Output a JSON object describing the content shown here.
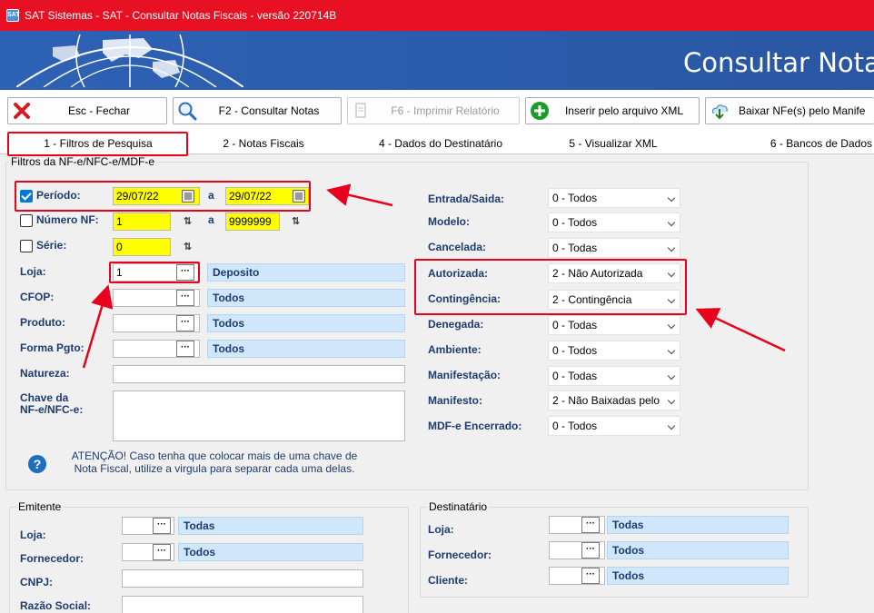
{
  "window": {
    "title": "SAT Sistemas - SAT - Consultar Notas Fiscais - versão 220714B",
    "icon_text": "SAT"
  },
  "banner": {
    "title": "Consultar Notas"
  },
  "toolbar": {
    "close_label": "Esc - Fechar",
    "consult_label": "F2 - Consultar Notas",
    "print_label": "F6 - Imprimir Relatório",
    "insert_xml_label": "Inserir pelo arquivo XML",
    "download_label": "Baixar NFe(s) pelo Manife"
  },
  "tabs": [
    {
      "label": "1 - Filtros de Pesquisa"
    },
    {
      "label": "2 - Notas Fiscais"
    },
    {
      "label": "4 - Dados do Destinatário"
    },
    {
      "label": "5 - Visualizar XML"
    },
    {
      "label": "6 - Bancos de Dados"
    }
  ],
  "filters": {
    "group_title": "Filtros da NF-e/NFC-e/MDF-e",
    "periodo": {
      "label": "Período:",
      "checked": true,
      "from": "29/07/22",
      "to": "29/07/22"
    },
    "numero": {
      "label": "Número NF:",
      "checked": false,
      "from": "1",
      "to": "9999999"
    },
    "serie": {
      "label": "Série:",
      "checked": false,
      "value": "0"
    },
    "range_sep": "a",
    "loja": {
      "label": "Loja:",
      "value": "1",
      "desc": "Deposito"
    },
    "cfop": {
      "label": "CFOP:",
      "value": "",
      "desc": "Todos"
    },
    "produto": {
      "label": "Produto:",
      "value": "",
      "desc": "Todos"
    },
    "forma_pgto": {
      "label": "Forma Pgto:",
      "value": "",
      "desc": "Todos"
    },
    "natureza": {
      "label": "Natureza:",
      "value": ""
    },
    "chave": {
      "label_line1": "Chave da",
      "label_line2": "NF-e/NFC-e:",
      "value": ""
    },
    "ellipsis": "···",
    "note_line1": "ATENÇÃO! Caso tenha que colocar mais de uma chave de",
    "note_line2": "Nota Fiscal, utilize a virgula para separar cada uma delas.",
    "note_icon": "?"
  },
  "right_filters": [
    {
      "label": "Entrada/Saida:",
      "value": "0 - Todos"
    },
    {
      "label": "Modelo:",
      "value": "0 - Todos"
    },
    {
      "label": "Cancelada:",
      "value": "0 - Todas"
    },
    {
      "label": "Autorizada:",
      "value": "2 - Não Autorizada"
    },
    {
      "label": "Contingência:",
      "value": "2 - Contingência"
    },
    {
      "label": "Denegada:",
      "value": "0 - Todas"
    },
    {
      "label": "Ambiente:",
      "value": "0 - Todos"
    },
    {
      "label": "Manifestação:",
      "value": "0 - Todas"
    },
    {
      "label": "Manifesto:",
      "value": "2 - Não Baixadas pelo"
    },
    {
      "label": "MDF-e Encerrado:",
      "value": "0 - Todos"
    }
  ],
  "emitente": {
    "group_title": "Emitente",
    "loja": {
      "label": "Loja:",
      "desc": "Todas"
    },
    "fornecedor": {
      "label": "Fornecedor:",
      "desc": "Todos"
    },
    "cnpj": {
      "label": "CNPJ:"
    },
    "razao": {
      "label": "Razão Social:"
    }
  },
  "destinatario": {
    "group_title": "Destinatário",
    "loja": {
      "label": "Loja:",
      "desc": "Todas"
    },
    "fornecedor": {
      "label": "Fornecedor:",
      "desc": "Todos"
    },
    "cliente": {
      "label": "Cliente:",
      "desc": "Todos"
    }
  },
  "colors": {
    "titlebar": "#e81123",
    "banner": "#2b5cac",
    "highlight_field": "#ffff00",
    "desc_field": "#cfe6fb",
    "label_text": "#1e3c70",
    "annotation_red": "#e8001c"
  }
}
